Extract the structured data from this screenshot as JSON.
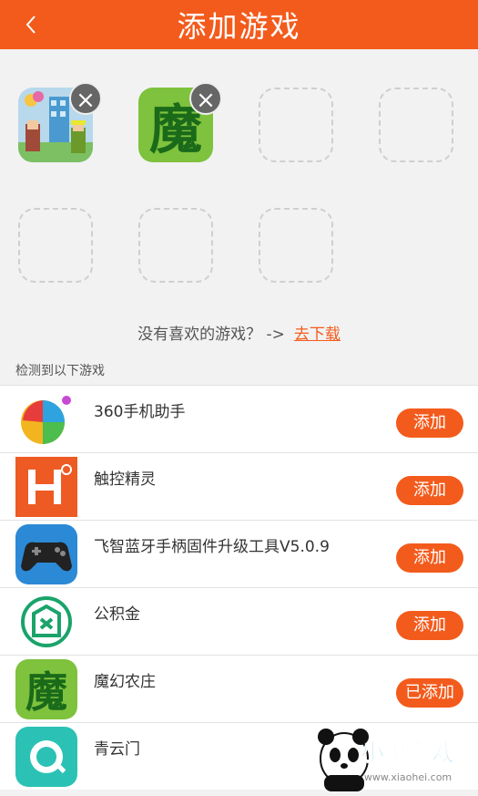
{
  "header": {
    "title": "添加游戏",
    "back_icon": "chevron-left-icon"
  },
  "slots": [
    {
      "state": "filled",
      "game": "pixel-town-game-icon",
      "remove_label": "×"
    },
    {
      "state": "filled",
      "game": "魔",
      "remove_label": "×"
    },
    {
      "state": "empty"
    },
    {
      "state": "empty"
    },
    {
      "state": "empty"
    },
    {
      "state": "empty"
    },
    {
      "state": "empty"
    }
  ],
  "prompt": {
    "text": "没有喜欢的游戏？ ->",
    "link": "去下载"
  },
  "section_title": "检测到以下游戏",
  "apps": [
    {
      "name": "360手机助手",
      "action": "添加"
    },
    {
      "name": "触控精灵",
      "action": "添加"
    },
    {
      "name": "飞智蓝牙手柄固件升级工具V5.0.9",
      "action": "添加"
    },
    {
      "name": "公积金",
      "action": "添加"
    },
    {
      "name": "魔幻农庄",
      "action": "已添加"
    },
    {
      "name": "青云门",
      "action": ""
    }
  ],
  "watermark": {
    "text": "小黑游戏",
    "url": "www.xiaohei.com"
  },
  "colors": {
    "accent": "#f35b1c",
    "background": "#f2f2f2"
  }
}
